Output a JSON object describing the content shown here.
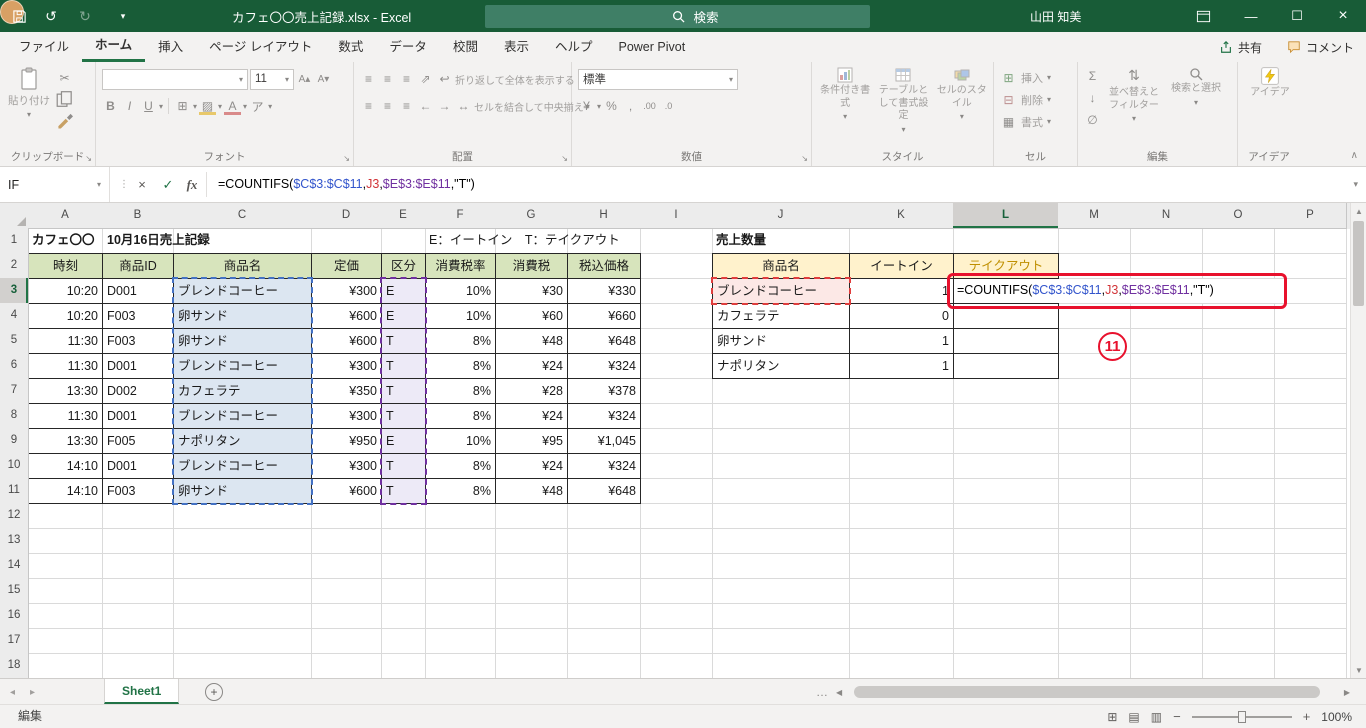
{
  "colors": {
    "titlebar": "#185c37",
    "accent": "#217346",
    "ref_blue": "#4472c4",
    "ref_red": "#e03e3e",
    "ref_purple": "#7030a0",
    "annotation_red": "#e8112d",
    "header_green_fill": "#d7e4bc",
    "summary_header_fill": "#fff2cc",
    "summary_header_accent_text": "#bf8f00",
    "blue_fill": "#dce6f1",
    "purple_fill": "#edeaf7",
    "red_fill": "#fce8e6"
  },
  "titlebar": {
    "title": "カフェ〇〇売上記録.xlsx  -  Excel",
    "search_placeholder": "検索",
    "user_name": "山田 知美"
  },
  "ribbon_tabs": {
    "items": [
      {
        "label": "ファイル",
        "active": false
      },
      {
        "label": "ホーム",
        "active": true
      },
      {
        "label": "挿入",
        "active": false
      },
      {
        "label": "ページ レイアウト",
        "active": false
      },
      {
        "label": "数式",
        "active": false
      },
      {
        "label": "データ",
        "active": false
      },
      {
        "label": "校閲",
        "active": false
      },
      {
        "label": "表示",
        "active": false
      },
      {
        "label": "ヘルプ",
        "active": false
      },
      {
        "label": "Power Pivot",
        "active": false
      }
    ],
    "share_label": "共有",
    "comments_label": "コメント"
  },
  "ribbon": {
    "clipboard_group": "クリップボード",
    "paste_label": "貼り付け",
    "font_group": "フォント",
    "font_name": "",
    "font_size": "11",
    "alignment_group": "配置",
    "wrap_label": "折り返して全体を表示する",
    "merge_label": "セルを結合して中央揃え",
    "number_group": "数値",
    "number_format": "標準",
    "styles_group": "スタイル",
    "conditional_label": "条件付き書式",
    "format_table_label": "テーブルとして書式設定",
    "cell_styles_label": "セルのスタイル",
    "cells_group": "セル",
    "insert_label": "挿入",
    "delete_label": "削除",
    "format_label": "書式",
    "editing_group": "編集",
    "sort_label": "並べ替えとフィルター",
    "find_label": "検索と選択",
    "ideas_group": "アイデア",
    "ideas_label": "アイデア"
  },
  "formula_bar": {
    "name_box": "IF",
    "fx_label": "fx",
    "formula_plain": "=COUNTIFS($C$3:$C$11,J3,$E$3:$E$11,\"T\")"
  },
  "formula_parts": [
    {
      "text": "=COUNTIFS(",
      "color": "#000000"
    },
    {
      "text": "$C$3:$C$11",
      "color": "#3355cc"
    },
    {
      "text": ",",
      "color": "#000000"
    },
    {
      "text": "J3",
      "color": "#d13438"
    },
    {
      "text": ",",
      "color": "#000000"
    },
    {
      "text": "$E$3:$E$11",
      "color": "#7030a0"
    },
    {
      "text": ",",
      "color": "#000000"
    },
    {
      "text": "\"T\")",
      "color": "#000000"
    }
  ],
  "sheet": {
    "column_letters": [
      "A",
      "B",
      "C",
      "D",
      "E",
      "F",
      "G",
      "H",
      "I",
      "J",
      "K",
      "L",
      "M",
      "N",
      "O",
      "P"
    ],
    "row_count": 18,
    "active_column": "L",
    "active_row": 3,
    "title_cell": "カフェ〇〇　10月16日売上記録",
    "legend_cell": "E：イートイン　T：テイクアウト",
    "summary_title_cell": "売上数量",
    "main_table": {
      "headers": [
        "時刻",
        "商品ID",
        "商品名",
        "定価",
        "区分",
        "消費税率",
        "消費税",
        "税込価格"
      ],
      "rows": [
        [
          "10:20",
          "D001",
          "ブレンドコーヒー",
          "¥300",
          "E",
          "10%",
          "¥30",
          "¥330"
        ],
        [
          "10:20",
          "F003",
          "卵サンド",
          "¥600",
          "E",
          "10%",
          "¥60",
          "¥660"
        ],
        [
          "11:30",
          "F003",
          "卵サンド",
          "¥600",
          "T",
          "8%",
          "¥48",
          "¥648"
        ],
        [
          "11:30",
          "D001",
          "ブレンドコーヒー",
          "¥300",
          "T",
          "8%",
          "¥24",
          "¥324"
        ],
        [
          "13:30",
          "D002",
          "カフェラテ",
          "¥350",
          "T",
          "8%",
          "¥28",
          "¥378"
        ],
        [
          "11:30",
          "D001",
          "ブレンドコーヒー",
          "¥300",
          "T",
          "8%",
          "¥24",
          "¥324"
        ],
        [
          "13:30",
          "F005",
          "ナポリタン",
          "¥950",
          "E",
          "10%",
          "¥95",
          "¥1,045"
        ],
        [
          "14:10",
          "D001",
          "ブレンドコーヒー",
          "¥300",
          "T",
          "8%",
          "¥24",
          "¥324"
        ],
        [
          "14:10",
          "F003",
          "卵サンド",
          "¥600",
          "T",
          "8%",
          "¥48",
          "¥648"
        ]
      ]
    },
    "summary_table": {
      "headers": [
        "商品名",
        "イートイン",
        "テイクアウト"
      ],
      "rows": [
        [
          "ブレンドコーヒー",
          "1"
        ],
        [
          "カフェラテ",
          "0"
        ],
        [
          "卵サンド",
          "1"
        ],
        [
          "ナポリタン",
          "1"
        ]
      ]
    },
    "annotation_number": "11"
  },
  "tabs_bar": {
    "sheet_name": "Sheet1"
  },
  "status_bar": {
    "mode": "編集",
    "zoom": "100%"
  },
  "icons": {
    "undo": "↺",
    "redo": "↻",
    "caret": "▾",
    "dots": "⋮",
    "minimize": "—",
    "maximize": "☐",
    "close": "×",
    "cut": "✂",
    "grow_font": "A▴",
    "shrink_font": "A▾",
    "bold": "B",
    "italic": "I",
    "underline": "U",
    "borders": "⊞",
    "fill": "▨",
    "font_color_letter": "A",
    "phonetic": "ア",
    "align": "≡",
    "orientation": "⇗",
    "wrap": "↩",
    "merge": "↔",
    "indent_left": "←",
    "indent_right": "→",
    "currency": "¥",
    "percent": "%",
    "comma": ",",
    "dec_more": ".00",
    "dec_less": ".0",
    "autosum": "Σ",
    "fill_down": "↓",
    "clear": "∅",
    "sort": "⇅",
    "cells_insert": "⊞",
    "cells_delete": "⊟",
    "cells_format": "▦",
    "cancel": "×",
    "enter": "✓",
    "launcher": "↘",
    "chevron_up": "∧",
    "plus": "+",
    "nav_left": "◂",
    "nav_right": "▸",
    "scroll_left": "◀",
    "scroll_right": "▶",
    "scroll_up": "▲",
    "scroll_down": "▼",
    "ellipsis": "…",
    "view_normal": "⊞",
    "view_layout": "▤",
    "view_break": "▥",
    "zoom_out": "−",
    "zoom_in": "+"
  }
}
